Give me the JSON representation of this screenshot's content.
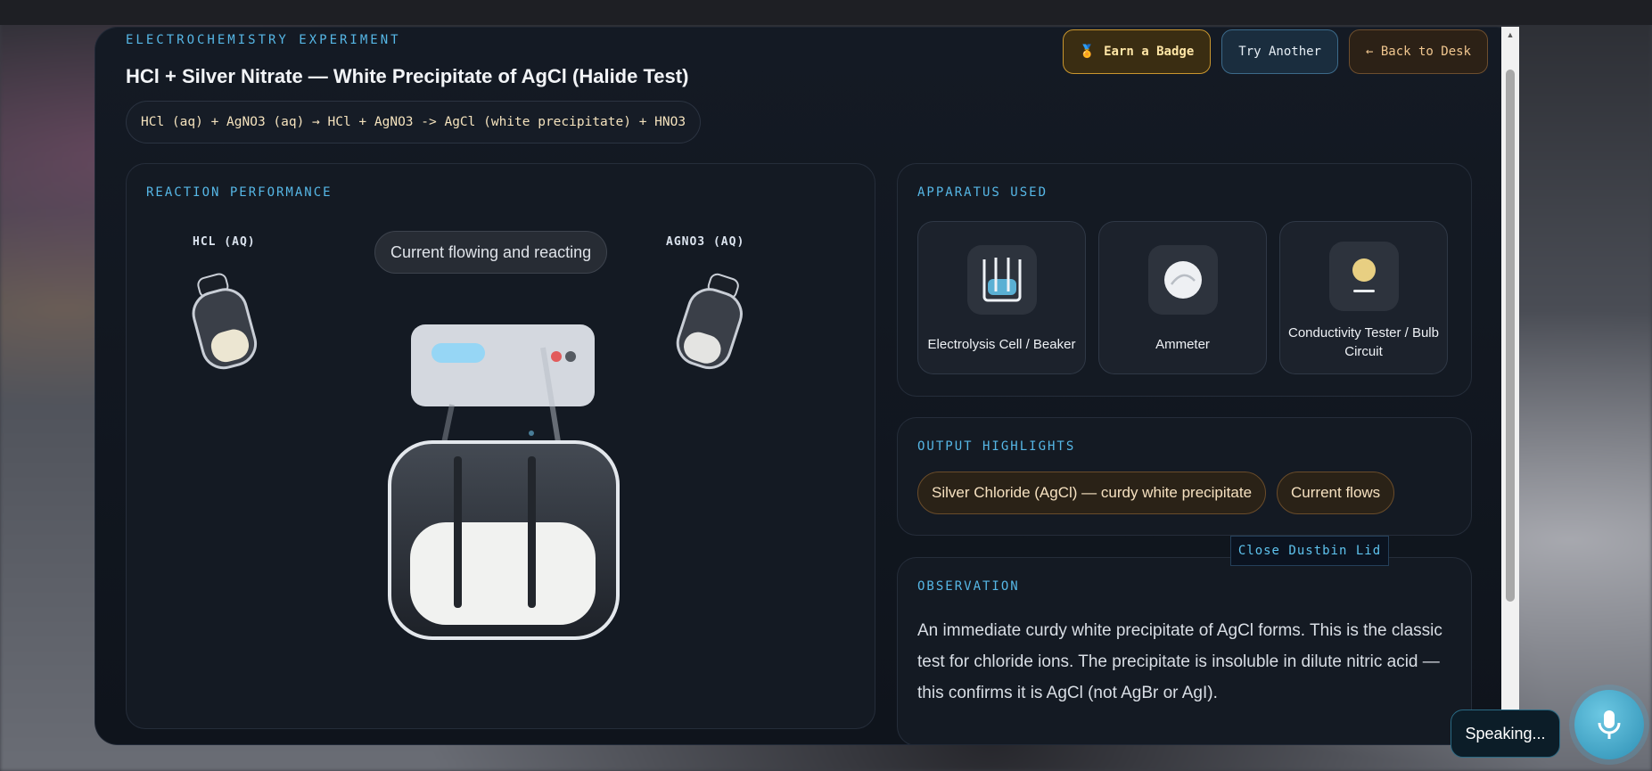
{
  "header": {
    "eyebrow": "ELECTROCHEMISTRY EXPERIMENT",
    "title": "HCl + Silver Nitrate — White Precipitate of AgCl (Halide Test)",
    "equation": "HCl (aq) + AgNO3 (aq) → HCl + AgNO3 -> AgCl (white precipitate) + HNO3"
  },
  "actions": {
    "earn_badge": "Earn a Badge",
    "badge_icon": "🏅",
    "try_another": "Try Another",
    "back_to_desk": "← Back to Desk"
  },
  "reaction": {
    "label": "REACTION PERFORMANCE",
    "reagent_left": "HCL (AQ)",
    "reagent_right": "AGNO3 (AQ)",
    "status": "Current flowing and reacting"
  },
  "apparatus": {
    "label": "APPARATUS USED",
    "items": [
      {
        "label": "Electrolysis Cell / Beaker",
        "icon": "beaker-icon"
      },
      {
        "label": "Ammeter",
        "icon": "ammeter-icon"
      },
      {
        "label": "Conductivity Tester / Bulb Circuit",
        "icon": "bulb-icon"
      }
    ]
  },
  "output": {
    "label": "OUTPUT HIGHLIGHTS",
    "chips": [
      "Silver Chloride (AgCl) — curdy white precipitate",
      "Current flows"
    ]
  },
  "observation": {
    "label": "OBSERVATION",
    "text": "An immediate curdy white precipitate of AgCl forms. This is the classic test for chloride ions. The precipitate is insoluble in dilute nitric acid — this confirms it is AgCl (not AgBr or AgI)."
  },
  "overlay": {
    "dustbin": "Close Dustbin Lid",
    "speaking": "Speaking..."
  },
  "colors": {
    "accent": "#56b7e6",
    "badge_border": "#c9962e",
    "chip_border": "#6a4c2a"
  }
}
